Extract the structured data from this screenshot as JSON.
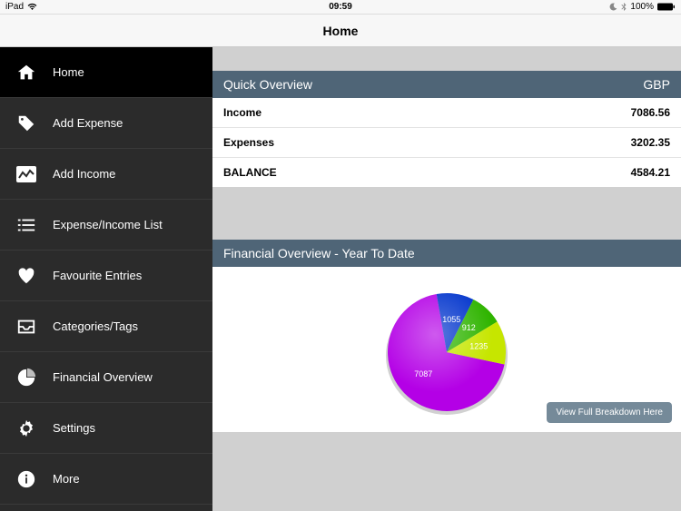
{
  "status_bar": {
    "device": "iPad",
    "time": "09:59",
    "battery_pct": "100%"
  },
  "header": {
    "title": "Home"
  },
  "sidebar": {
    "items": [
      {
        "label": "Home"
      },
      {
        "label": "Add Expense"
      },
      {
        "label": "Add Income"
      },
      {
        "label": "Expense/Income List"
      },
      {
        "label": "Favourite Entries"
      },
      {
        "label": "Categories/Tags"
      },
      {
        "label": "Financial Overview"
      },
      {
        "label": "Settings"
      },
      {
        "label": "More"
      }
    ]
  },
  "quick_overview": {
    "title": "Quick Overview",
    "currency": "GBP",
    "rows": [
      {
        "label": "Income",
        "value": "7086.56"
      },
      {
        "label": "Expenses",
        "value": "3202.35"
      },
      {
        "label": "BALANCE",
        "value": "4584.21"
      }
    ]
  },
  "financial_overview": {
    "title": "Financial Overview - Year To Date",
    "breakdown_button": "View Full Breakdown Here"
  },
  "chart_data": {
    "type": "pie",
    "title": "Financial Overview - Year To Date",
    "slices": [
      {
        "label": "7087",
        "value": 7087,
        "color": "#b400e6"
      },
      {
        "label": "1055",
        "value": 1055,
        "color": "#0033cc"
      },
      {
        "label": "912",
        "value": 912,
        "color": "#2fb400"
      },
      {
        "label": "1235",
        "value": 1235,
        "color": "#c6e600"
      }
    ]
  }
}
